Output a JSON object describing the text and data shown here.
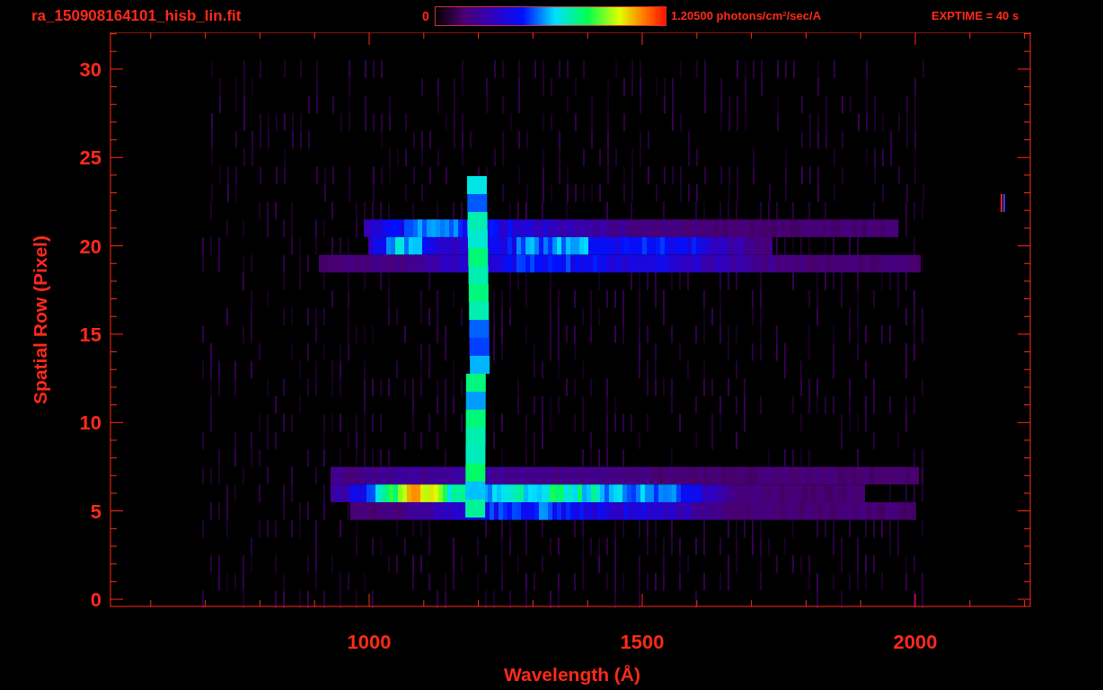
{
  "title": "ra_150908164101_hisb_lin.fit",
  "colorbar": {
    "min_label": "0",
    "max_label": "1.20500 photons/cm$^{2}$/sec/A"
  },
  "exposure": "EXPTIME = 40 s",
  "plot": {
    "xlabel": "Wavelength (Å)",
    "ylabel": "Spatial Row (Pixel)",
    "xticks": [
      "1000",
      "1500",
      "2000"
    ],
    "yticks": [
      "30",
      "25",
      "20",
      "15",
      "10",
      "5",
      "0"
    ]
  }
}
